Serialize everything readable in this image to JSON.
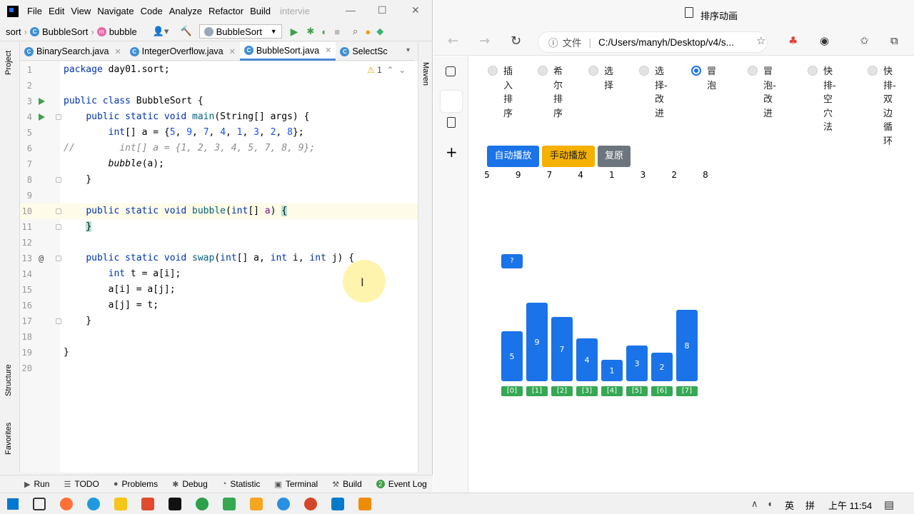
{
  "ide": {
    "menu": [
      "File",
      "Edit",
      "View",
      "Navigate",
      "Code",
      "Analyze",
      "Refactor",
      "Build"
    ],
    "title": "intervie",
    "breadcrumb": [
      "sort",
      "BubbleSort",
      "bubble"
    ],
    "run_config": "BubbleSort",
    "tabs": [
      "BinarySearch.java",
      "IntegerOverflow.java",
      "BubbleSort.java",
      "SelectSc"
    ],
    "active_tab": "BubbleSort.java",
    "left_labels": {
      "project": "Project",
      "structure": "Structure",
      "favorites": "Favorites"
    },
    "right_label": "Maven",
    "warning_count": "1",
    "bottom_tools": [
      "Run",
      "TODO",
      "Problems",
      "Debug",
      "Statistic",
      "Terminal",
      "Build",
      "Event Log"
    ],
    "event_log_badge": "2",
    "code": {
      "l1": "package day01.sort;",
      "l3": "public class BubbleSort {",
      "l4": "public static void main(String[] args) {",
      "l5": "int[] a = {5, 9, 7, 4, 1, 3, 2, 8};",
      "l6": "//        int[] a = {1, 2, 3, 4, 5, 7, 8, 9};",
      "l7": "bubble(a);",
      "l8": "}",
      "l10": "public static void bubble(int[] a) {",
      "l11": "}",
      "l13": "public static void swap(int[] a, int i, int j) {",
      "l14": "int t = a[i];",
      "l15": "a[i] = a[j];",
      "l16": "a[j] = t;",
      "l17": "}",
      "l19": "}"
    }
  },
  "browser": {
    "tab_title": "排序动画",
    "address_prefix": "文件",
    "address": "C:/Users/manyh/Desktop/v4/s...",
    "radios": [
      {
        "label": "插入排序",
        "selected": false
      },
      {
        "label": "希尔排序",
        "selected": false
      },
      {
        "label": "选择",
        "selected": false
      },
      {
        "label": "选择-改进",
        "selected": false
      },
      {
        "label": "冒泡",
        "selected": true
      },
      {
        "label": "冒泡-改进",
        "selected": false
      },
      {
        "label": "快排-空穴法",
        "selected": false
      },
      {
        "label": "快排-双边循环",
        "selected": false
      }
    ],
    "buttons": {
      "auto": "自动播放",
      "manual": "手动播放",
      "reset": "复原"
    },
    "button_colors": {
      "auto": "#1a73e8",
      "manual": "#f6b000",
      "reset": "#6c757d"
    },
    "array": [
      "5",
      "9",
      "7",
      "4",
      "1",
      "3",
      "2",
      "8"
    ],
    "pending_label": "?",
    "indices": [
      "[0]",
      "[1]",
      "[2]",
      "[3]",
      "[4]",
      "[5]",
      "[6]",
      "[7]"
    ]
  },
  "chart_data": {
    "type": "bar",
    "categories": [
      "[0]",
      "[1]",
      "[2]",
      "[3]",
      "[4]",
      "[5]",
      "[6]",
      "[7]"
    ],
    "values": [
      5,
      9,
      7,
      4,
      1,
      3,
      2,
      8
    ]
  },
  "taskbar": {
    "ime": "英",
    "ime2": "拼",
    "time": "上午 11:54"
  }
}
